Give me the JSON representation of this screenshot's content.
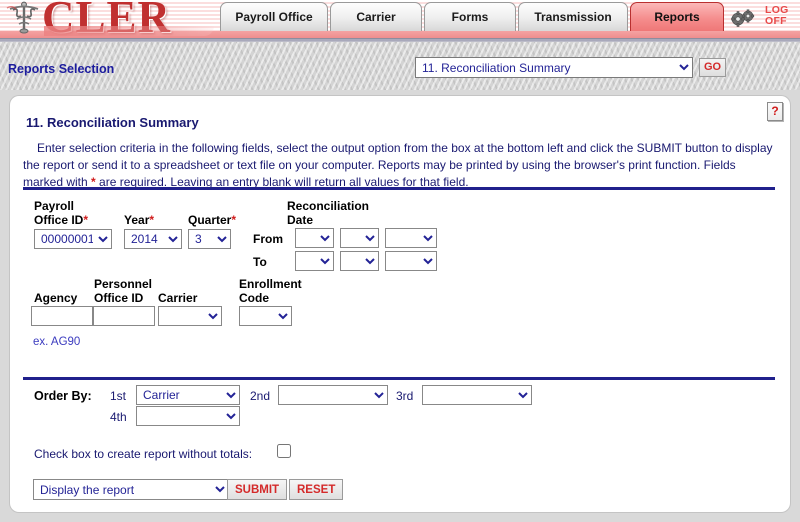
{
  "app": {
    "logo_text": "CLER",
    "logo_icon": "caduceus-icon",
    "logoff_line1": "LOG",
    "logoff_line2": "OFF",
    "gear_icon": "gears-icon"
  },
  "nav": {
    "tabs": [
      {
        "label": "Payroll Office",
        "active": false
      },
      {
        "label": "Carrier",
        "active": false
      },
      {
        "label": "Forms",
        "active": false
      },
      {
        "label": "Transmission",
        "active": false
      },
      {
        "label": "Reports",
        "active": true
      }
    ]
  },
  "selection_bar": {
    "label": "Reports Selection",
    "report_selected": "11. Reconciliation Summary",
    "go_label": "GO"
  },
  "panel": {
    "help_icon_label": "?",
    "title": "11. Reconciliation Summary",
    "instructions_part1": "Enter selection criteria in the following fields, select the output option from the box at the bottom left and click the SUBMIT button to display the report or send it to a spreadsheet or text file on your computer.  Reports may be printed by using the browser's print function.  Fields marked with ",
    "instructions_asterisk": "*",
    "instructions_part2": " are required.  Leaving an entry blank will return all values for that field."
  },
  "form": {
    "payroll_office": {
      "label_line1": "Payroll",
      "label_line2": "Office ID",
      "required": "*",
      "value": "00000001"
    },
    "year": {
      "label": "Year",
      "required": "*",
      "value": "2014"
    },
    "quarter": {
      "label": "Quarter",
      "required": "*",
      "value": "3"
    },
    "reconciliation_date": {
      "label_line1": "Reconciliation",
      "label_line2": "Date",
      "from_label": "From",
      "to_label": "To",
      "from_month": "",
      "from_day": "",
      "from_year": "",
      "to_month": "",
      "to_day": "",
      "to_year": ""
    },
    "agency": {
      "label": "Agency",
      "value": ""
    },
    "personnel_office": {
      "label_line1": "Personnel",
      "label_line2": "Office ID",
      "value": ""
    },
    "carrier": {
      "label": "Carrier",
      "value": ""
    },
    "enrollment_code": {
      "label_line1": "Enrollment",
      "label_line2": "Code",
      "value": ""
    },
    "example_hint": "ex. AG90"
  },
  "order_by": {
    "label": "Order By:",
    "n1_label": "1st",
    "n1_value": "Carrier",
    "n2_label": "2nd",
    "n2_value": "",
    "n3_label": "3rd",
    "n3_value": "",
    "n4_label": "4th",
    "n4_value": ""
  },
  "options": {
    "checkbox_label": "Check box to create report without totals:",
    "checkbox_checked": false,
    "output_value": "Display the report",
    "submit_label": "SUBMIT",
    "reset_label": "RESET"
  },
  "colors": {
    "brand_red": "#c03030",
    "accent_red": "#d42a2a",
    "navy": "#191970",
    "divider": "#20208c",
    "active_tab": "#f58e8e"
  }
}
